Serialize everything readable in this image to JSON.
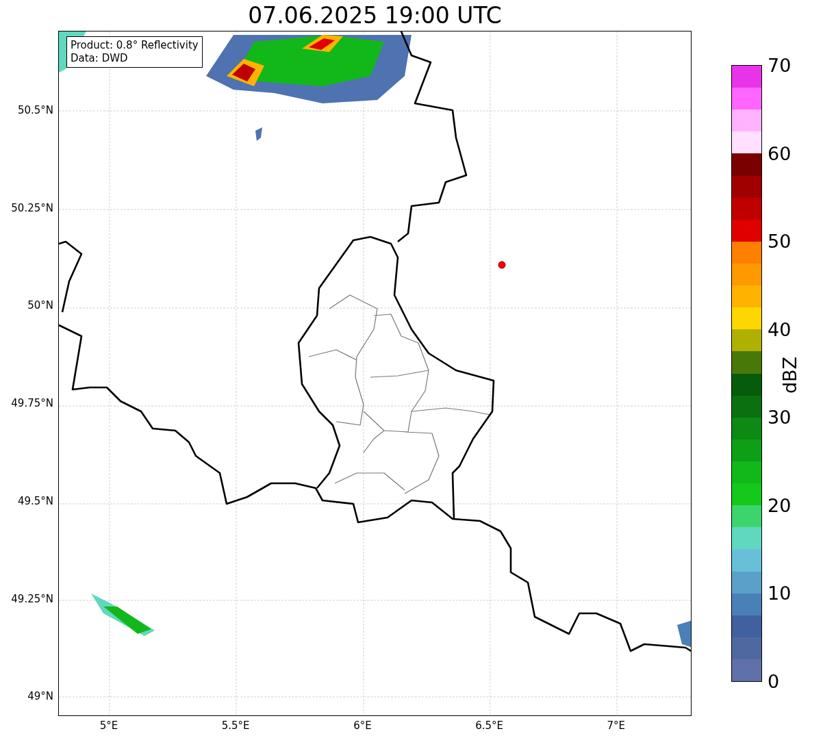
{
  "title": "07.06.2025 19:00 UTC",
  "info_box": [
    "Product: 0.8° Reflectivity",
    "Data: DWD"
  ],
  "map": {
    "lat_ticks": [
      "50.5°N",
      "50.25°N",
      "50°N",
      "49.75°N",
      "49.5°N",
      "49.25°N",
      "49°N"
    ],
    "lon_ticks": [
      "5°E",
      "5.5°E",
      "6°E",
      "6.5°E",
      "7°E"
    ]
  },
  "colorbar": {
    "label": "dBZ",
    "ticks": [
      "70",
      "60",
      "50",
      "40",
      "30",
      "20",
      "10",
      "0"
    ],
    "bands": [
      {
        "color": "#e933e9"
      },
      {
        "color": "#ff66ff"
      },
      {
        "color": "#ffb3ff"
      },
      {
        "color": "#ffe0ff"
      },
      {
        "color": "#7a0000"
      },
      {
        "color": "#a00000"
      },
      {
        "color": "#c00000"
      },
      {
        "color": "#e00000"
      },
      {
        "color": "#ff7f00"
      },
      {
        "color": "#ff9900"
      },
      {
        "color": "#ffb300"
      },
      {
        "color": "#ffd700"
      },
      {
        "color": "#b0b000"
      },
      {
        "color": "#487808"
      },
      {
        "color": "#065c0a"
      },
      {
        "color": "#0a7010"
      },
      {
        "color": "#0c8a14"
      },
      {
        "color": "#0f9f17"
      },
      {
        "color": "#12b81a"
      },
      {
        "color": "#14c81c"
      },
      {
        "color": "#3cd46c"
      },
      {
        "color": "#60d8c0"
      },
      {
        "color": "#68c0d8"
      },
      {
        "color": "#5aa0c8"
      },
      {
        "color": "#4a80b8"
      },
      {
        "color": "#4060a0"
      },
      {
        "color": "#5068a0"
      },
      {
        "color": "#6070a8"
      }
    ]
  }
}
